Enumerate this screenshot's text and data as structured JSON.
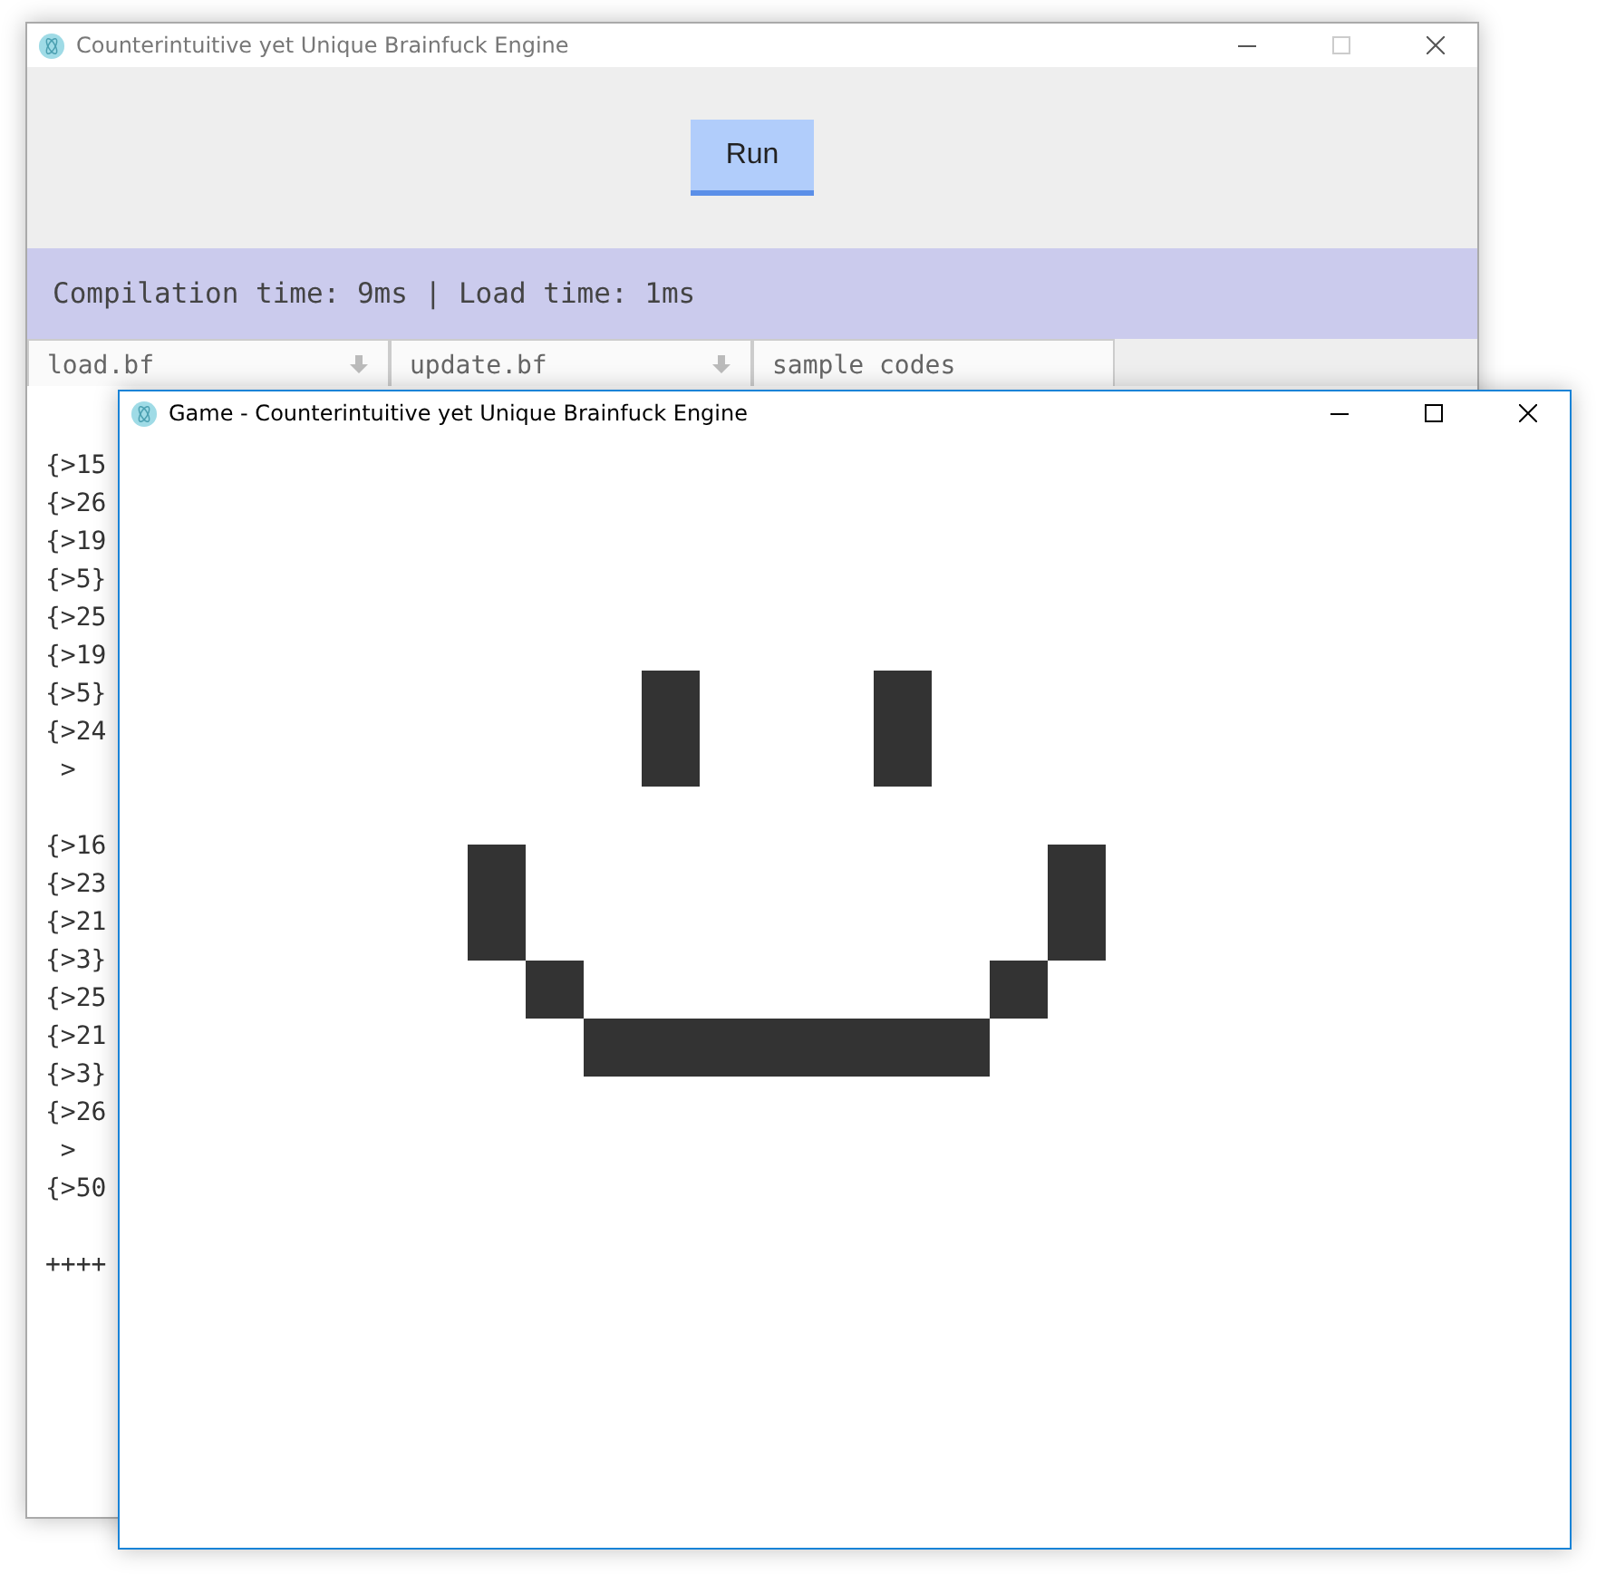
{
  "main_window": {
    "title": "Counterintuitive yet Unique Brainfuck Engine",
    "run_button": "Run",
    "status": "Compilation time: 9ms | Load time: 1ms",
    "tabs": [
      {
        "label": "load.bf"
      },
      {
        "label": "update.bf"
      },
      {
        "label": "sample codes"
      }
    ],
    "code_blocks": [
      [
        "{>15",
        "{>26",
        "{>19",
        "{>5}",
        "{>25",
        "{>19",
        "{>5}",
        "{>24",
        " >"
      ],
      [
        "{>16",
        "{>23",
        "{>21",
        "{>3}",
        "{>25",
        "{>21",
        "{>3}",
        "{>26",
        " >",
        "{>50"
      ],
      [
        "++++"
      ]
    ]
  },
  "game_window": {
    "title": "Game - Counterintuitive yet Unique Brainfuck Engine"
  }
}
